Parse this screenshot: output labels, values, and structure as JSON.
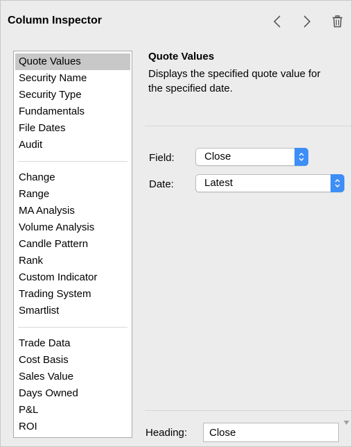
{
  "header": {
    "title": "Column Inspector"
  },
  "nav": {
    "back_icon": "chevron-left-icon",
    "forward_icon": "chevron-right-icon",
    "delete_icon": "trash-icon"
  },
  "categories": {
    "groups": [
      [
        "Quote Values",
        "Security Name",
        "Security Type",
        "Fundamentals",
        "File Dates",
        "Audit"
      ],
      [
        "Change",
        "Range",
        "MA Analysis",
        "Volume Analysis",
        "Candle Pattern",
        "Rank",
        "Custom Indicator",
        "Trading System",
        "Smartlist"
      ],
      [
        "Trade Data",
        "Cost Basis",
        "Sales Value",
        "Days Owned",
        "P&L",
        "ROI"
      ]
    ],
    "selected": "Quote Values"
  },
  "detail": {
    "title": "Quote Values",
    "description": "Displays the specified quote value for the specified date."
  },
  "fields": {
    "field": {
      "label": "Field:",
      "value": "Close"
    },
    "date": {
      "label": "Date:",
      "value": "Latest"
    }
  },
  "heading": {
    "label": "Heading:",
    "value": "Close"
  },
  "colors": {
    "accent": "#3d8ef6",
    "selection": "#c8c8c8",
    "background": "#ececec"
  }
}
